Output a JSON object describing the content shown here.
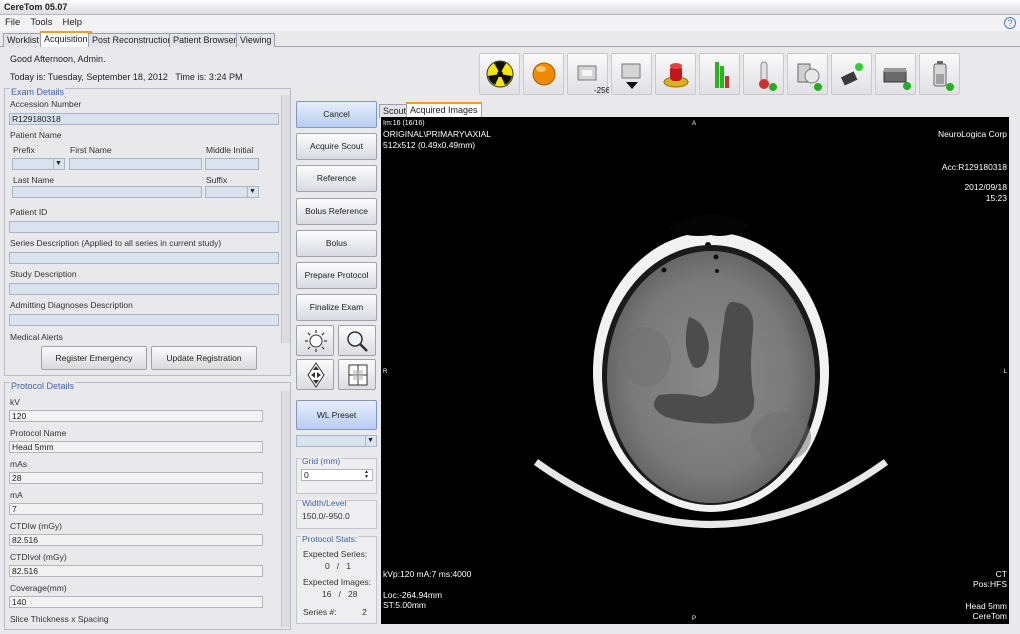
{
  "app": {
    "title": "CereTom 05.07"
  },
  "menu": [
    {
      "label": "File"
    },
    {
      "label": "Tools"
    },
    {
      "label": "Help"
    }
  ],
  "help_label": "?",
  "tabs": [
    {
      "label": "Worklist"
    },
    {
      "label": "Acquisition"
    },
    {
      "label": "Post Reconstruction"
    },
    {
      "label": "Patient Browser"
    },
    {
      "label": "Viewing"
    }
  ],
  "greeting": "Good Afternoon, Admin.",
  "today": "Today is: Tuesday, September 18, 2012   Time is: 3:24 PM",
  "toolbar": {
    "dose_value": "-256"
  },
  "exam": {
    "title": "Exam Details",
    "accession_label": "Accession Number",
    "accession_value": "R129180318",
    "patient_name_label": "Patient Name",
    "prefix_label": "Prefix",
    "first_label": "First Name",
    "middle_label": "Middle Initial",
    "last_label": "Last Name",
    "suffix_label": "Suffix",
    "patient_id_label": "Patient ID",
    "series_desc_label": "Series Description (Applied to all series in current study)",
    "study_desc_label": "Study Description",
    "admitting_label": "Admitting Diagnoses Description",
    "alerts_label": "Medical Alerts",
    "register_emergency": "Register Emergency",
    "update_registration": "Update Registration"
  },
  "protocol": {
    "title": "Protocol Details",
    "fields": [
      {
        "label": "kV",
        "value": "120"
      },
      {
        "label": "Protocol Name",
        "value": "Head 5mm"
      },
      {
        "label": "mAs",
        "value": "28"
      },
      {
        "label": "mA",
        "value": "7"
      },
      {
        "label": "CTDIw (mGy)",
        "value": "82.516"
      },
      {
        "label": "CTDIvol (mGy)",
        "value": "82.516"
      },
      {
        "label": "Coverage(mm)",
        "value": "140"
      },
      {
        "label": "Slice Thickness x Spacing",
        "value": ""
      }
    ]
  },
  "actions": {
    "cancel": "Cancel",
    "acquire_scout": "Acquire Scout",
    "reference": "Reference",
    "bolus_reference": "Bolus Reference",
    "bolus": "Bolus",
    "prepare_protocol": "Prepare Protocol",
    "finalize_exam": "Finalize Exam",
    "wl_preset": "WL Preset"
  },
  "grid": {
    "title": "Grid (mm)",
    "value": "0"
  },
  "width_level": {
    "title": "Width/Level",
    "value": "150.0/-950.0"
  },
  "stats": {
    "title": "Protocol Stats:",
    "expected_series_label": "Expected Series:",
    "expected_series_value": "0   /   1",
    "expected_images_label": "Expected Images:",
    "expected_images_value": "16   /   28",
    "series_no_label": "Series #:",
    "series_no_value": "2"
  },
  "image_tabs": [
    {
      "label": "Scout"
    },
    {
      "label": "Acquired Images"
    }
  ],
  "overlay": {
    "tl1": "Im:16 (16/16)",
    "tl2": "ORIGINAL\\PRIMARY\\AXIAL",
    "tl3": "512x512 (0.49x0.49mm)",
    "tr1": "NeuroLogica Corp",
    "tr2": "Acc:R129180318",
    "tr3": "2012/09/18",
    "tr4": "15:23",
    "top": "A",
    "bottom": "P",
    "left": "R",
    "right": "L",
    "bl1": "kVp:120 mA:7 ms:4000",
    "bl2": "Loc:-264.94mm",
    "bl3": "ST:5.00mm",
    "br1": "CT",
    "br2": "Pos:HFS",
    "br3": "Head 5mm",
    "br4": "CereTom"
  }
}
